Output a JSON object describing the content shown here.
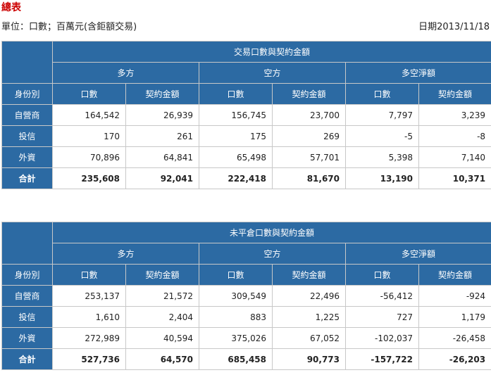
{
  "page": {
    "title": "總表",
    "unit": "單位：口數；百萬元(含鉅額交易)",
    "date": "日期2013/11/18"
  },
  "tables": [
    {
      "caption": "交易口數與契約金額",
      "groups": [
        "多方",
        "空方",
        "多空淨額"
      ],
      "row_header": "身份別",
      "col_headers": [
        "口數",
        "契約金額",
        "口數",
        "契約金額",
        "口數",
        "契約金額"
      ],
      "rows": [
        {
          "label": "自營商",
          "values": [
            "164,542",
            "26,939",
            "156,745",
            "23,700",
            "7,797",
            "3,239"
          ]
        },
        {
          "label": "投信",
          "values": [
            "170",
            "261",
            "175",
            "269",
            "-5",
            "-8"
          ]
        },
        {
          "label": "外資",
          "values": [
            "70,896",
            "64,841",
            "65,498",
            "57,701",
            "5,398",
            "7,140"
          ]
        },
        {
          "label": "合計",
          "values": [
            "235,608",
            "92,041",
            "222,418",
            "81,670",
            "13,190",
            "10,371"
          ]
        }
      ]
    },
    {
      "caption": "未平倉口數與契約金額",
      "groups": [
        "多方",
        "空方",
        "多空淨額"
      ],
      "row_header": "身份別",
      "col_headers": [
        "口數",
        "契約金額",
        "口數",
        "契約金額",
        "口數",
        "契約金額"
      ],
      "rows": [
        {
          "label": "自營商",
          "values": [
            "253,137",
            "21,572",
            "309,549",
            "22,496",
            "-56,412",
            "-924"
          ]
        },
        {
          "label": "投信",
          "values": [
            "1,610",
            "2,404",
            "883",
            "1,225",
            "727",
            "1,179"
          ]
        },
        {
          "label": "外資",
          "values": [
            "272,989",
            "40,594",
            "375,026",
            "67,052",
            "-102,037",
            "-26,458"
          ]
        },
        {
          "label": "合計",
          "values": [
            "527,736",
            "64,570",
            "685,458",
            "90,773",
            "-157,722",
            "-26,203"
          ]
        }
      ]
    }
  ]
}
